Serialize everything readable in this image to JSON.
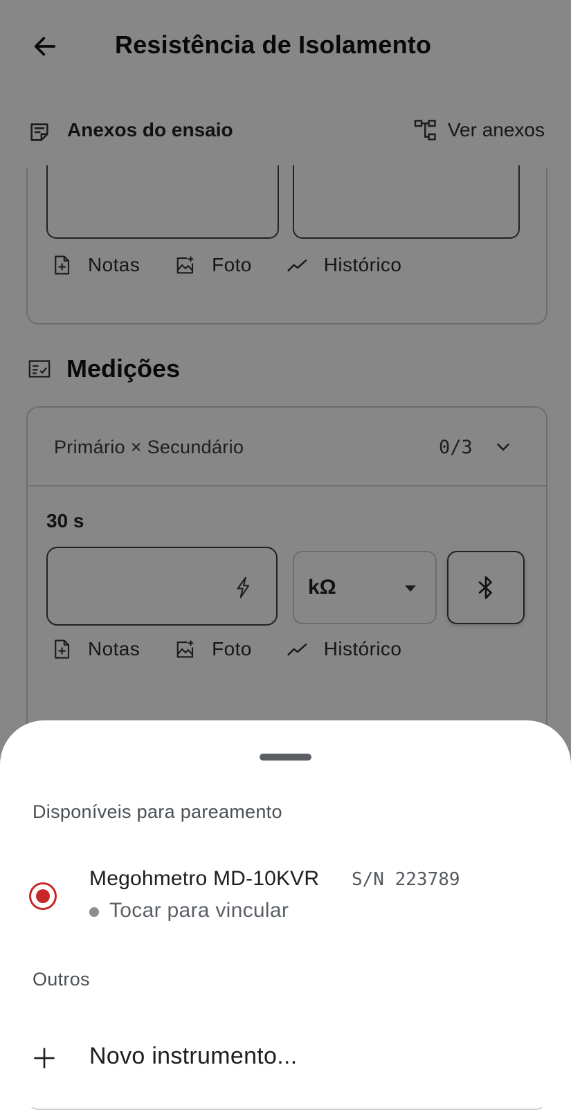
{
  "header": {
    "title": "Resistência de Isolamento"
  },
  "attachments": {
    "title": "Anexos do ensaio",
    "view_label": "Ver anexos",
    "actions": {
      "notes": "Notas",
      "photo": "Foto",
      "history": "Histórico"
    }
  },
  "measurements": {
    "title": "Medições",
    "group_label": "Primário × Secundário",
    "group_count": "0/3",
    "time_label": "30 s",
    "value": "",
    "unit": "kΩ",
    "actions": {
      "notes": "Notas",
      "photo": "Foto",
      "history": "Histórico"
    }
  },
  "sheet": {
    "available_label": "Disponíveis para pareamento",
    "device": {
      "name": "Megohmetro MD-10KVR",
      "serial": "S/N 223789",
      "status": "Tocar para vincular"
    },
    "others_label": "Outros",
    "new_instrument_label": "Novo instrumento..."
  },
  "colors": {
    "accent": "#c62828",
    "scrim": "rgba(0,0,0,0.47)"
  }
}
